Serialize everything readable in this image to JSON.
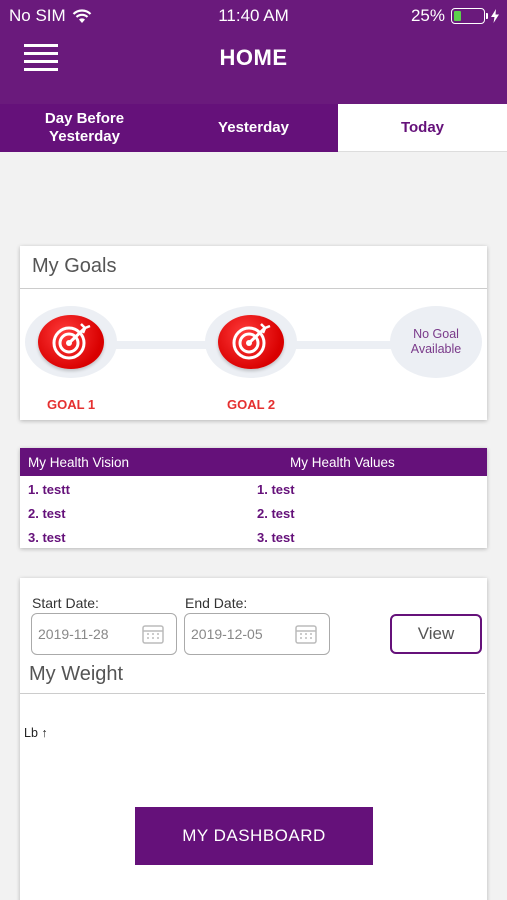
{
  "status_bar": {
    "carrier": "No SIM",
    "time": "11:40 AM",
    "battery_percent": "25%",
    "battery_level": 0.25
  },
  "header": {
    "title": "HOME",
    "menu_icon": "hamburger-icon"
  },
  "tabs": [
    {
      "label": "Day Before Yesterday",
      "active": false
    },
    {
      "label": "Yesterday",
      "active": false
    },
    {
      "label": "Today",
      "active": true
    }
  ],
  "goals": {
    "title": "My Goals",
    "items": [
      {
        "label": "GOAL 1",
        "icon": "target-icon"
      },
      {
        "label": "GOAL 2",
        "icon": "target-icon"
      }
    ],
    "empty_label": "No Goal Available"
  },
  "health": {
    "vision_header": "My Health Vision",
    "values_header": "My Health Values",
    "vision": [
      "1. testt",
      "2. test",
      "3. test"
    ],
    "values": [
      "1. test",
      "2. test",
      "3. test"
    ]
  },
  "weight": {
    "start_label": "Start Date:",
    "start_value": "2019-11-28",
    "end_label": "End Date:",
    "end_value": "2019-12-05",
    "view_label": "View",
    "title": "My Weight",
    "unit_label": "Lb ↑",
    "dashboard_label": "MY DASHBOARD"
  },
  "colors": {
    "primary": "#65117a",
    "accent_red": "#e53030",
    "battery_green": "#5cd04c"
  }
}
